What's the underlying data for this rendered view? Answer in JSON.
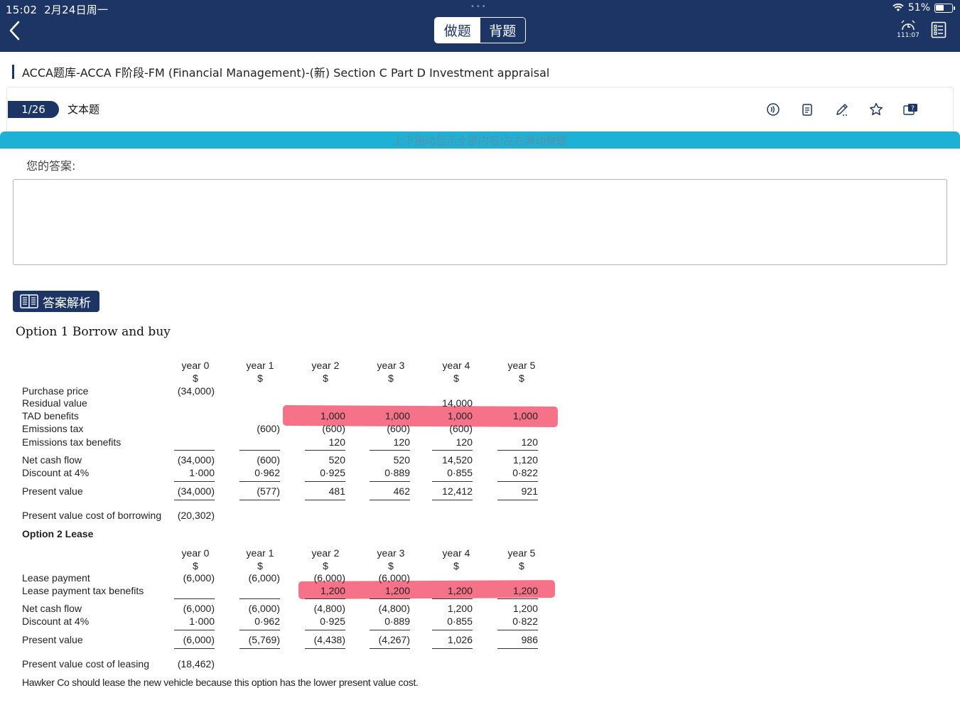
{
  "status_bar": {
    "time": "15:02",
    "date": "2月24日周一",
    "battery": "51%"
  },
  "header": {
    "mode_do": "做题",
    "mode_recite": "背题",
    "timer": "111:07"
  },
  "breadcrumb": "ACCA题库-ACCA F阶段-FM (Financial Management)-(新) Section C  Part D Investment appraisal",
  "question": {
    "index": "1/26",
    "type": "文本题",
    "tools": [
      "audio-icon",
      "note-icon",
      "edit-icon",
      "star-icon",
      "feedback-icon"
    ]
  },
  "hint": "上下拖动显示全部内容/左右滑动做题",
  "answer": {
    "label": "您的答案:",
    "value": ""
  },
  "analysis": {
    "button_label": "答案解析",
    "option1_title": "Option 1 Borrow and buy",
    "years": [
      "year 0",
      "year 1",
      "year 2",
      "year 3",
      "year 4",
      "year 5"
    ],
    "currency": [
      "$",
      "$",
      "$",
      "$",
      "$",
      "$"
    ],
    "option1": {
      "purchase_price": {
        "label": "Purchase price",
        "values": [
          "(34,000)",
          "",
          "",
          "",
          "",
          ""
        ]
      },
      "residual_value": {
        "label": "Residual value",
        "values": [
          "",
          "",
          "",
          "",
          "14,000",
          ""
        ]
      },
      "tad_benefits": {
        "label": "TAD benefits",
        "values": [
          "",
          "",
          "1,000",
          "1,000",
          "1,000",
          "1,000"
        ]
      },
      "emissions_tax": {
        "label": "Emissions tax",
        "values": [
          "",
          "(600)",
          "(600)",
          "(600)",
          "(600)",
          ""
        ]
      },
      "emissions_tax_benefits": {
        "label": "Emissions tax benefits",
        "values": [
          "",
          "",
          "120",
          "120",
          "120",
          "120"
        ]
      },
      "net_cash_flow": {
        "label": "Net cash flow",
        "values": [
          "(34,000)",
          "(600)",
          "520",
          "520",
          "14,520",
          "1,120"
        ]
      },
      "discount": {
        "label": "Discount at 4%",
        "values": [
          "1·000",
          "0·962",
          "0·925",
          "0·889",
          "0·855",
          "0·822"
        ]
      },
      "present_value": {
        "label": "Present value",
        "values": [
          "(34,000)",
          "(577)",
          "481",
          "462",
          "12,412",
          "921"
        ]
      },
      "pv_cost": {
        "label": "Present value cost of borrowing",
        "value": "(20,302)"
      }
    },
    "option2_title": "Option 2 Lease",
    "option2": {
      "lease_payment": {
        "label": "Lease payment",
        "values": [
          "(6,000)",
          "(6,000)",
          "(6,000)",
          "(6,000)",
          "",
          ""
        ]
      },
      "lease_tax_benefits": {
        "label": "Lease payment tax benefits",
        "values": [
          "",
          "",
          "1,200",
          "1,200",
          "1,200",
          "1,200"
        ]
      },
      "net_cash_flow": {
        "label": "Net cash flow",
        "values": [
          "(6,000)",
          "(6,000)",
          "(4,800)",
          "(4,800)",
          "1,200",
          "1,200"
        ]
      },
      "discount": {
        "label": "Discount at 4%",
        "values": [
          "1·000",
          "0·962",
          "0·925",
          "0·889",
          "0·855",
          "0·822"
        ]
      },
      "present_value": {
        "label": "Present value",
        "values": [
          "(6,000)",
          "(5,769)",
          "(4,438)",
          "(4,267)",
          "1,026",
          "986"
        ]
      },
      "pv_cost": {
        "label": "Present value cost of leasing",
        "value": "(18,462)"
      }
    },
    "conclusion": "Hawker Co should lease the new vehicle because this option has the lower present value cost."
  },
  "colors": {
    "navy": "#1c3565",
    "cyan": "#1eb1d6",
    "highlight": "#f33c5a"
  }
}
